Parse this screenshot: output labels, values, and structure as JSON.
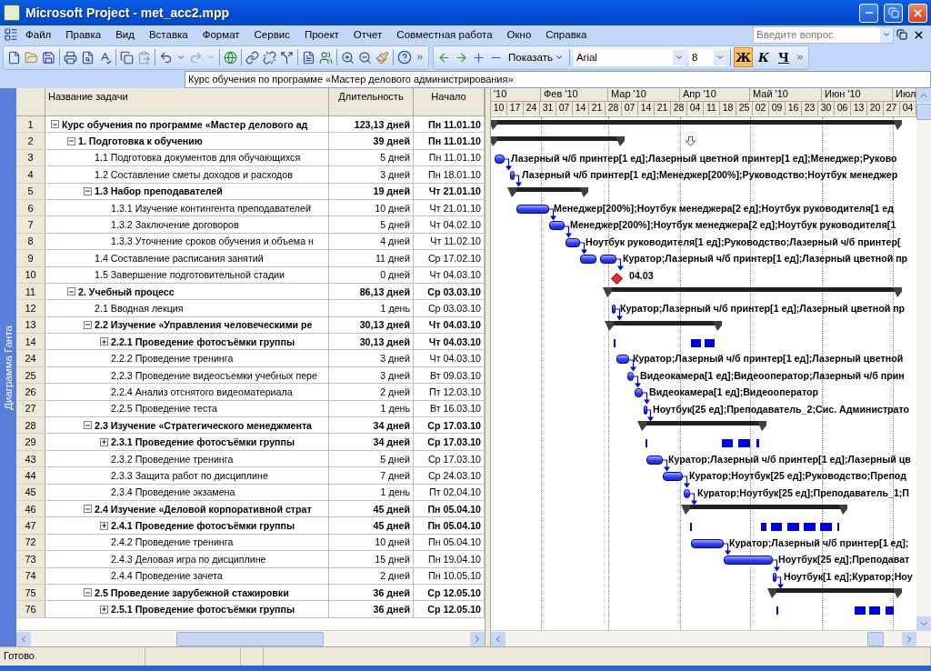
{
  "window": {
    "title": "Microsoft Project - met_acc2.mpp"
  },
  "menu": [
    "Файл",
    "Правка",
    "Вид",
    "Вставка",
    "Формат",
    "Сервис",
    "Проект",
    "Отчет",
    "Совместная работа",
    "Окно",
    "Справка"
  ],
  "help_search": {
    "placeholder": "Введите вопрос"
  },
  "format_toolbar": {
    "show_button": "Показать",
    "font": "Arial",
    "font_size": "8",
    "bold": {
      "label": "Ж",
      "on": true
    },
    "italic": {
      "label": "К",
      "on": false
    },
    "underline": {
      "label": "Ч",
      "on": false
    }
  },
  "entry_bar": {
    "value": "Курс обучения по программе «Мастер делового администрирования»"
  },
  "view_bar": {
    "label": "Диаграмма Ганта"
  },
  "timescale": {
    "months": [
      "'10",
      "Фев '10",
      "Мар '10",
      "Апр '10",
      "Май '10",
      "Июн '10",
      "Июл"
    ],
    "weeks": [
      "10",
      "17",
      "24",
      "31",
      "07",
      "14",
      "21",
      "28",
      "07",
      "14",
      "21",
      "28",
      "04",
      "11",
      "18",
      "25",
      "02",
      "09",
      "16",
      "23",
      "30",
      "06",
      "13",
      "20",
      "27",
      "04"
    ]
  },
  "table": {
    "columns": [
      "Название задачи",
      "Длительность",
      "Начало"
    ],
    "rows": [
      {
        "id": "1",
        "name": "Курс обучения по программе «Мастер делового ад",
        "duration": "123,13 дней",
        "start": "Пн 11.01.10",
        "kind": "summary",
        "expanded": true,
        "children": [
          {
            "id": "2",
            "name": "1. Подготовка к обучению",
            "duration": "39 дней",
            "start": "Пн 11.01.10",
            "kind": "summary",
            "expanded": true,
            "children": [
              {
                "id": "3",
                "name": "1.1 Подготовка документов для обучающихся",
                "duration": "5 дней",
                "start": "Пн 11.01.10",
                "kind": "task",
                "resources": "Лазерный ч/б принтер[1 ед];Лазерный цветной принтер[1 ед];Менеджер;Руково"
              },
              {
                "id": "4",
                "name": "1.2 Составление сметы доходов и расходов",
                "duration": "3 дней",
                "start": "Пн 18.01.10",
                "kind": "task",
                "resources": "Лазерный ч/б принтер[1 ед];Менеджер[200%];Руководство;Ноутбук менеджер"
              },
              {
                "id": "5",
                "name": "1.3 Набор преподавателей",
                "duration": "19 дней",
                "start": "Чт 21.01.10",
                "kind": "summary",
                "expanded": true,
                "children": [
                  {
                    "id": "6",
                    "name": "1.3.1 Изучение контингента преподавателей",
                    "duration": "10 дней",
                    "start": "Чт 21.01.10",
                    "kind": "task",
                    "resources": "Менеджер[200%];Ноутбук менеджера[2 ед];Ноутбук руководителя[1 ед"
                  },
                  {
                    "id": "7",
                    "name": "1.3.2 Заключение договоров",
                    "duration": "5 дней",
                    "start": "Чт 04.02.10",
                    "kind": "task",
                    "resources": "Менеджер[200%];Ноутбук менеджера[2 ед];Ноутбук руководителя[1"
                  },
                  {
                    "id": "8",
                    "name": "1.3.3 Уточнение сроков обучения и объема н",
                    "duration": "4 дней",
                    "start": "Чт 11.02.10",
                    "kind": "task",
                    "resources": "Ноутбук руководителя[1 ед];Руководство;Лазерный ч/б принтер["
                  }
                ]
              },
              {
                "id": "9",
                "name": "1.4 Составление расписания занятий",
                "duration": "11 дней",
                "start": "Ср 17.02.10",
                "kind": "task",
                "resources": "Куратор;Лазерный ч/б принтер[1 ед];Лазерный цветной пр"
              },
              {
                "id": "10",
                "name": "1.5 Завершение подготовительной стадии",
                "duration": "0 дней",
                "start": "Чт 04.03.10",
                "kind": "milestone",
                "resources": "04.03"
              }
            ]
          },
          {
            "id": "11",
            "name": "2. Учебный процесс",
            "duration": "86,13 дней",
            "start": "Ср 03.03.10",
            "kind": "summary",
            "expanded": true,
            "children": [
              {
                "id": "12",
                "name": "2.1 Вводная лекция",
                "duration": "1 день",
                "start": "Ср 03.03.10",
                "kind": "task",
                "resources": "Куратор;Лазерный ч/б принтер[1 ед];Лазерный цветной пр"
              },
              {
                "id": "13",
                "name": "2.2 Изучение «Управления человеческими ре",
                "duration": "30,13 дней",
                "start": "Чт 04.03.10",
                "kind": "summary",
                "expanded": true,
                "children": [
                  {
                    "id": "14",
                    "name": "2.2.1 Проведение фотосъёмки группы",
                    "duration": "30,13 дней",
                    "start": "Чт 04.03.10",
                    "kind": "summary",
                    "expanded": false
                  },
                  {
                    "id": "24",
                    "name": "2.2.2 Проведение тренинга",
                    "duration": "3 дней",
                    "start": "Чт 04.03.10",
                    "kind": "task",
                    "resources": "Куратор;Лазерный ч/б принтер[1 ед];Лазерный цветной"
                  },
                  {
                    "id": "25",
                    "name": "2.2.3 Проведение видеосъемки учебных пере",
                    "duration": "3 дней",
                    "start": "Вт 09.03.10",
                    "kind": "task",
                    "resources": "Видеокамера[1 ед];Видеооператор;Лазерный ч/б прин"
                  },
                  {
                    "id": "26",
                    "name": "2.2.4 Анализ отснятого видеоматериала",
                    "duration": "2 дней",
                    "start": "Пт 12.03.10",
                    "kind": "task",
                    "resources": "Видеокамера[1 ед];Видеооператор"
                  },
                  {
                    "id": "27",
                    "name": "2.2.5 Проведение теста",
                    "duration": "1 день",
                    "start": "Вт 16.03.10",
                    "kind": "task",
                    "resources": "Ноутбук[25 ед];Преподаватель_2;Сис. Администрато"
                  }
                ]
              },
              {
                "id": "28",
                "name": "2.3 Изучение «Стратегического менеджмента",
                "duration": "34 дней",
                "start": "Ср 17.03.10",
                "kind": "summary",
                "expanded": true,
                "children": [
                  {
                    "id": "29",
                    "name": "2.3.1 Проведение фотосъёмки группы",
                    "duration": "34 дней",
                    "start": "Ср 17.03.10",
                    "kind": "summary",
                    "expanded": false
                  },
                  {
                    "id": "43",
                    "name": "2.3.2 Проведение тренинга",
                    "duration": "5 дней",
                    "start": "Ср 17.03.10",
                    "kind": "task",
                    "resources": "Куратор;Лазерный ч/б принтер[1 ед];Лазерный цв"
                  },
                  {
                    "id": "44",
                    "name": "2.3.3 Защита работ по дисциплине",
                    "duration": "7 дней",
                    "start": "Ср 24.03.10",
                    "kind": "task",
                    "resources": "Куратор;Ноутбук[25 ед];Руководство;Препод"
                  },
                  {
                    "id": "45",
                    "name": "2.3.4 Проведение экзамена",
                    "duration": "1 день",
                    "start": "Пт 02.04.10",
                    "kind": "task",
                    "resources": "Куратор;Ноутбук[25 ед];Преподаватель_1;П"
                  }
                ]
              },
              {
                "id": "46",
                "name": "2.4 Изучение «Деловой корпоративной страт",
                "duration": "45 дней",
                "start": "Пн 05.04.10",
                "kind": "summary",
                "expanded": true,
                "children": [
                  {
                    "id": "47",
                    "name": "2.4.1 Проведение фотосъёмки группы",
                    "duration": "45 дней",
                    "start": "Пн 05.04.10",
                    "kind": "summary",
                    "expanded": false
                  },
                  {
                    "id": "72",
                    "name": "2.4.2 Проведение тренинга",
                    "duration": "10 дней",
                    "start": "Пн 05.04.10",
                    "kind": "task",
                    "resources": "Куратор;Лазерный ч/б принтер[1 ед];"
                  },
                  {
                    "id": "73",
                    "name": "2.4.3 Деловая игра по дисциплине",
                    "duration": "15 дней",
                    "start": "Пн 19.04.10",
                    "kind": "task",
                    "resources": "Ноутбук[25 ед];Преподават"
                  },
                  {
                    "id": "74",
                    "name": "2.4.4 Проведение зачета",
                    "duration": "2 дней",
                    "start": "Пн 10.05.10",
                    "kind": "task",
                    "resources": "Ноутбук[1 ед];Куратор;Ноу"
                  }
                ]
              },
              {
                "id": "75",
                "name": "2.5 Проведение зарубежной стажировки",
                "duration": "36 дней",
                "start": "Ср 12.05.10",
                "kind": "summary",
                "expanded": true,
                "children": [
                  {
                    "id": "76",
                    "name": "2.5.1 Проведение фотосъёмки группы",
                    "duration": "36 дней",
                    "start": "Ср 12.05.10",
                    "kind": "summary",
                    "expanded": false
                  }
                ]
              }
            ]
          }
        ]
      }
    ]
  },
  "status_bar": {
    "text": "Готово"
  }
}
